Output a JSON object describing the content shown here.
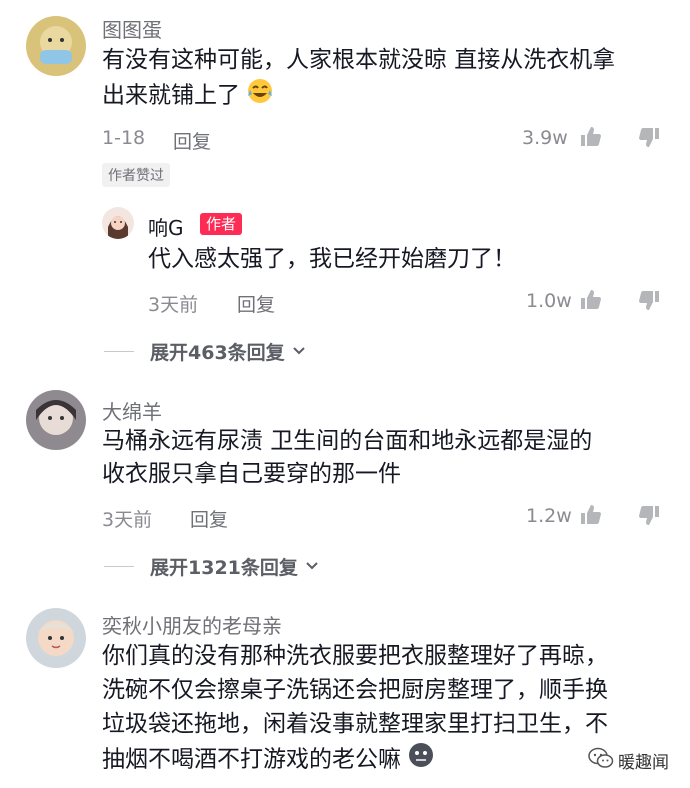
{
  "comments": [
    {
      "username": "图图蛋",
      "text_lines": [
        "有没有这种可能，人家根本就没晾 直接从洗衣机拿",
        "出来就铺上了"
      ],
      "emoji": "laughing-crying-emoji",
      "date": "1-18",
      "reply_label": "回复",
      "likes": "3.9w",
      "author_liked_badge": "作者赞过"
    },
    {
      "username": "大绵羊",
      "text_lines": [
        "马桶永远有尿渍 卫生间的台面和地永远都是湿的",
        "收衣服只拿自己要穿的那一件"
      ],
      "date": "3天前",
      "reply_label": "回复",
      "likes": "1.2w",
      "expand_label": "展开1321条回复"
    },
    {
      "username": "奕秋小朋友的老母亲",
      "text_lines": [
        "你们真的没有那种洗衣服要把衣服整理好了再晾，",
        "洗碗不仅会擦桌子洗锅还会把厨房整理了，顺手换",
        "垃圾袋还拖地，闲着没事就整理家里打扫卫生，不",
        "抽烟不喝酒不打游戏的老公嘛"
      ],
      "emoji": "dark-face-emoji"
    }
  ],
  "reply": {
    "username": "响G",
    "author_badge": "作者",
    "text": "代入感太强了，我已经开始磨刀了！",
    "date": "3天前",
    "reply_label": "回复",
    "likes": "1.0w",
    "expand_label": "展开463条回复"
  },
  "watermark": {
    "text": "暖趣闻",
    "icon": "wechat-icon"
  },
  "colors": {
    "accent": "#fe2c55",
    "text": "#161823",
    "secondary": "#8a8b91"
  }
}
